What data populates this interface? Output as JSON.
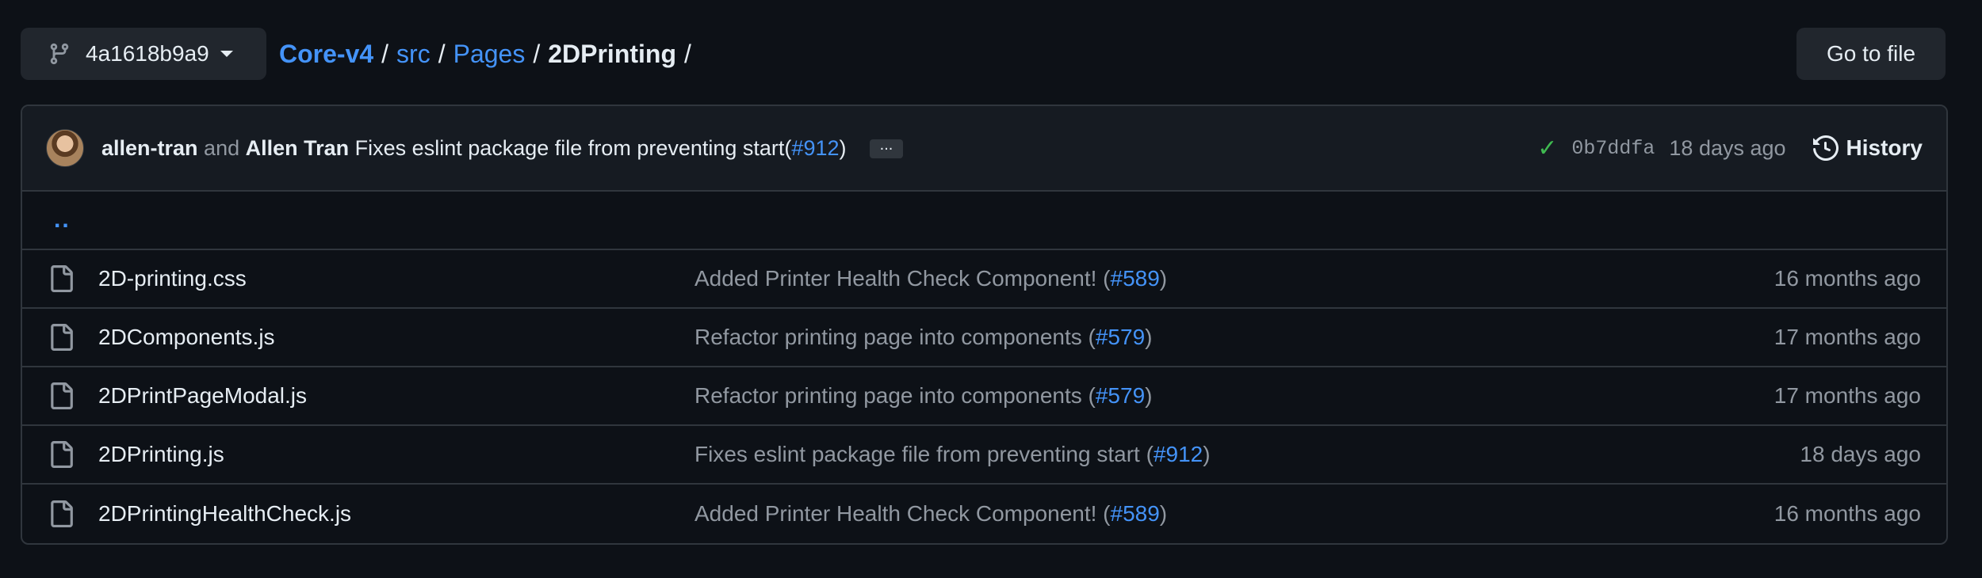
{
  "branch": {
    "name": "4a1618b9a9"
  },
  "breadcrumb": {
    "repo": "Core-v4",
    "crumbs": [
      "src",
      "Pages"
    ],
    "current": "2DPrinting",
    "separator": "/"
  },
  "goto_file_label": "Go to file",
  "commit": {
    "author1": "allen-tran",
    "and": "and",
    "author2": "Allen Tran",
    "message": "Fixes eslint package file from preventing start",
    "pr_open": "(",
    "pr": "#912",
    "pr_close": ")",
    "ellipsis": "...",
    "sha": "0b7ddfa",
    "age": "18 days ago",
    "history_label": "History",
    "status_color": "#3fb950"
  },
  "parent_dir": "..",
  "files": [
    {
      "name": "2D-printing.css",
      "message": "Added Printer Health Check Component! (",
      "pr": "#589",
      "close": ")",
      "age": "16 months ago"
    },
    {
      "name": "2DComponents.js",
      "message": "Refactor printing page into components (",
      "pr": "#579",
      "close": ")",
      "age": "17 months ago"
    },
    {
      "name": "2DPrintPageModal.js",
      "message": "Refactor printing page into components (",
      "pr": "#579",
      "close": ")",
      "age": "17 months ago"
    },
    {
      "name": "2DPrinting.js",
      "message": "Fixes eslint package file from preventing start (",
      "pr": "#912",
      "close": ")",
      "age": "18 days ago"
    },
    {
      "name": "2DPrintingHealthCheck.js",
      "message": "Added Printer Health Check Component! (",
      "pr": "#589",
      "close": ")",
      "age": "16 months ago"
    }
  ],
  "colors": {
    "background": "#0d1117",
    "accent": "#4493f8",
    "border": "#30363d",
    "muted": "#9198a1"
  }
}
